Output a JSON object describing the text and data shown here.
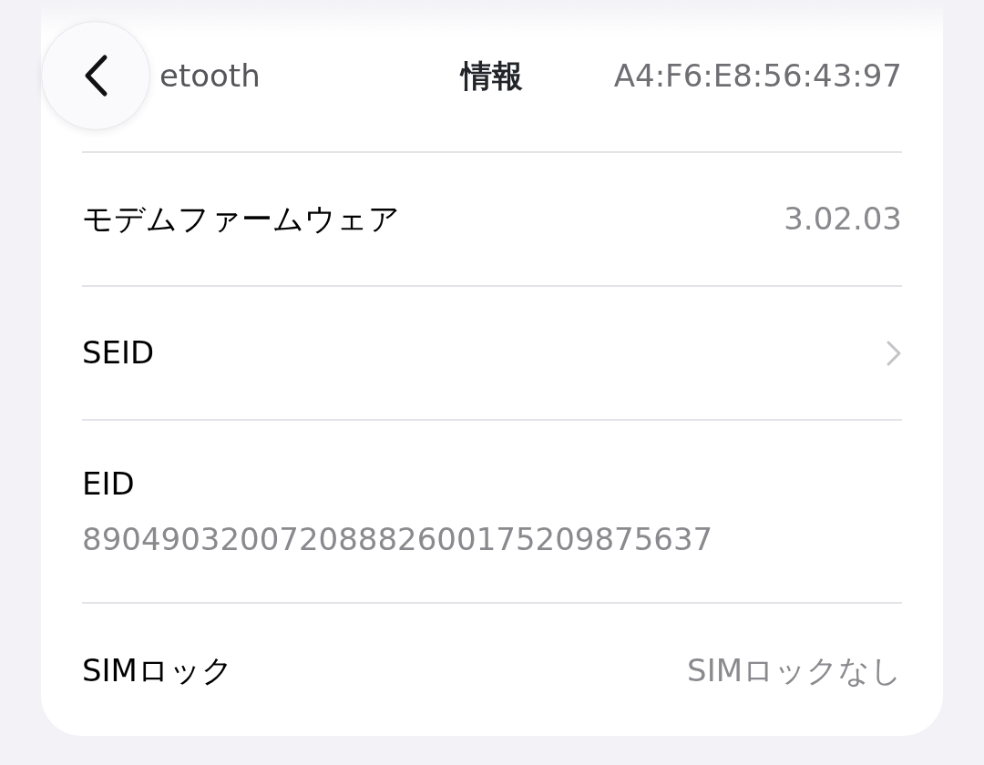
{
  "header": {
    "title": "情報"
  },
  "rows": [
    {
      "kind": "value",
      "label": "etooth",
      "value": "A4:F6:E8:56:43:97"
    },
    {
      "kind": "value",
      "label": "モデムファームウェア",
      "value": "3.02.03"
    },
    {
      "kind": "link",
      "label": "SEID"
    },
    {
      "kind": "subtitle",
      "label": "EID",
      "detail": "89049032007208882600175209875637"
    },
    {
      "kind": "value",
      "label": "SIMロック",
      "value": "SIMロックなし"
    }
  ]
}
